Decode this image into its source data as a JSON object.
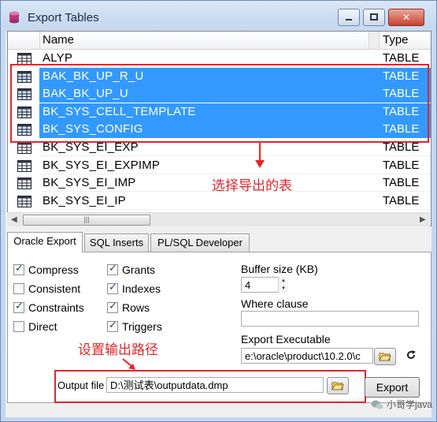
{
  "window": {
    "title": "Export Tables",
    "icon": "oracle-db-icon"
  },
  "grid": {
    "columns": {
      "name": "Name",
      "type": "Type"
    },
    "rows": [
      {
        "name": "ALYP",
        "type": "TABLE",
        "selected": false
      },
      {
        "name": "BAK_BK_UP_R_U",
        "type": "TABLE",
        "selected": true
      },
      {
        "name": "BAK_BK_UP_U",
        "type": "TABLE",
        "selected": true
      },
      {
        "name": "BK_SYS_CELL_TEMPLATE",
        "type": "TABLE",
        "selected": true
      },
      {
        "name": "BK_SYS_CONFIG",
        "type": "TABLE",
        "selected": true
      },
      {
        "name": "BK_SYS_EI_EXP",
        "type": "TABLE",
        "selected": false
      },
      {
        "name": "BK_SYS_EI_EXPIMP",
        "type": "TABLE",
        "selected": false
      },
      {
        "name": "BK_SYS_EI_IMP",
        "type": "TABLE",
        "selected": false
      },
      {
        "name": "BK_SYS_EI_IP",
        "type": "TABLE",
        "selected": false
      }
    ]
  },
  "annotations": {
    "select_tables": "选择导出的表",
    "set_output_path": "设置输出路径"
  },
  "tabs": [
    {
      "label": "Oracle Export",
      "active": true
    },
    {
      "label": "SQL Inserts",
      "active": false
    },
    {
      "label": "PL/SQL Developer",
      "active": false
    }
  ],
  "options_left": [
    {
      "label": "Compress",
      "checked": true
    },
    {
      "label": "Consistent",
      "checked": false
    },
    {
      "label": "Constraints",
      "checked": true
    },
    {
      "label": "Direct",
      "checked": false
    }
  ],
  "options_right": [
    {
      "label": "Grants",
      "checked": true
    },
    {
      "label": "Indexes",
      "checked": true
    },
    {
      "label": "Rows",
      "checked": true
    },
    {
      "label": "Triggers",
      "checked": true
    }
  ],
  "buffer": {
    "label": "Buffer size (KB)",
    "value": "4"
  },
  "where": {
    "label": "Where clause",
    "value": ""
  },
  "executable": {
    "label": "Export Executable",
    "value": "e:\\oracle\\product\\10.2.0\\c"
  },
  "output": {
    "label": "Output file",
    "value": "D:\\测试表\\outputdata.dmp"
  },
  "export_button": "Export",
  "watermark": "小哥学java",
  "colors": {
    "selection": "#3399ff",
    "annotation": "#e3262b"
  }
}
